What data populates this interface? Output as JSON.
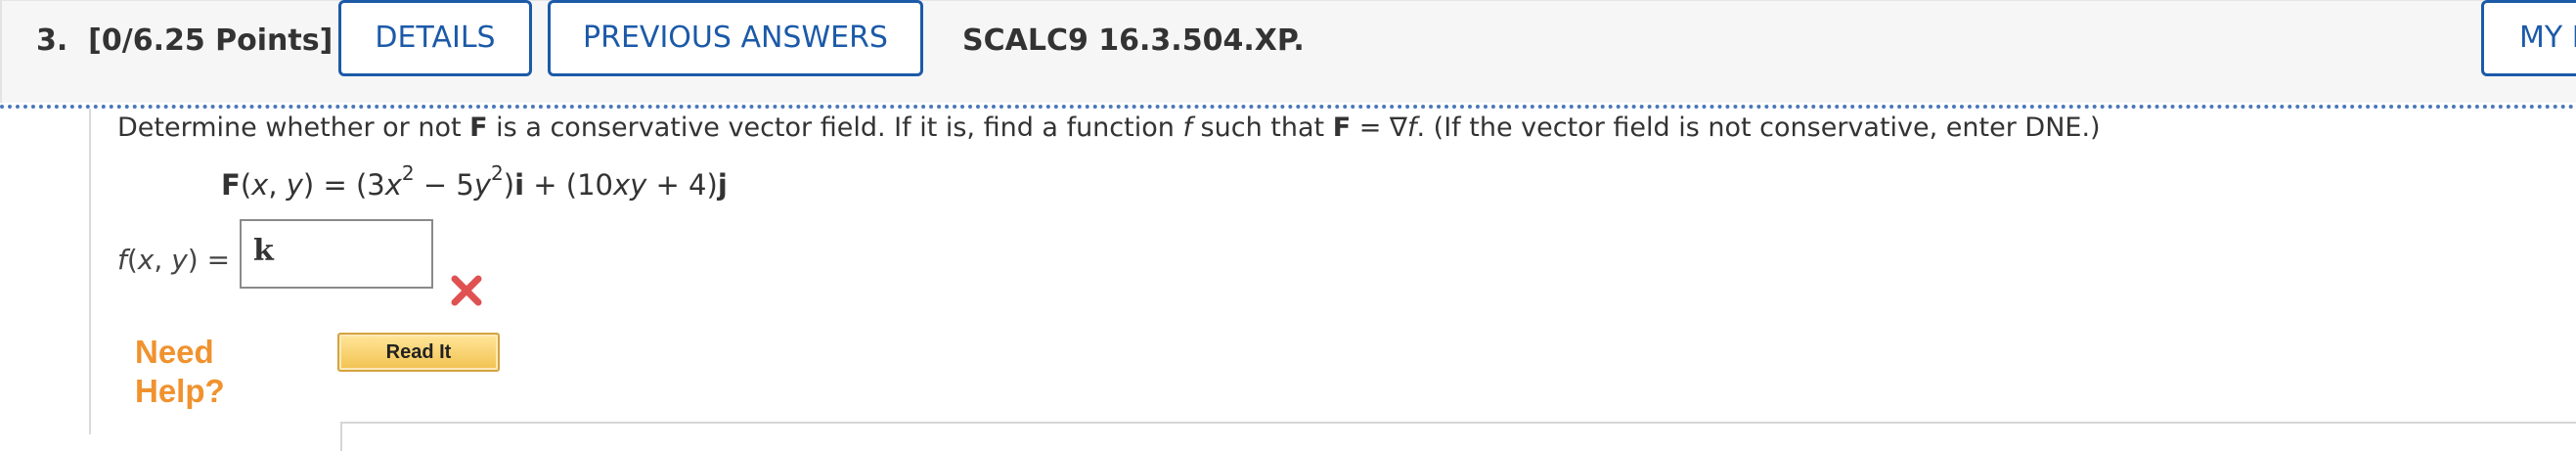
{
  "question": {
    "number_label": "3.",
    "points_label": "[0/6.25 Points]",
    "details_button": "DETAILS",
    "previous_answers_button": "PREVIOUS ANSWERS",
    "problem_code": "SCALC9 16.3.504.XP.",
    "my_notes_button": "MY NOTES"
  },
  "problem": {
    "statement_parts": [
      "Determine whether or not ",
      "F",
      " is a conservative vector field. If it is, find a function ",
      "f",
      " such that ",
      "F",
      " = ∇",
      "f",
      ". (If the vector field is not conservative, enter DNE.)"
    ],
    "formula_parts": [
      "F",
      "(",
      "x",
      ", ",
      "y",
      ") = (3",
      "x",
      "2",
      " − 5",
      "y",
      "2",
      ")",
      "i",
      " + (10",
      "xy",
      " + 4)",
      "j"
    ],
    "answer_label_parts": [
      "f",
      "(",
      "x",
      ", ",
      "y",
      ") ="
    ],
    "answer_value": "k",
    "answer_status": "incorrect"
  },
  "help": {
    "label": "Need Help?",
    "read_it_button": "Read It"
  },
  "colors": {
    "accent_blue": "#1c5aa8",
    "incorrect_red": "#e05252",
    "help_orange": "#f0922e",
    "button_gold": "#f2c24f"
  }
}
